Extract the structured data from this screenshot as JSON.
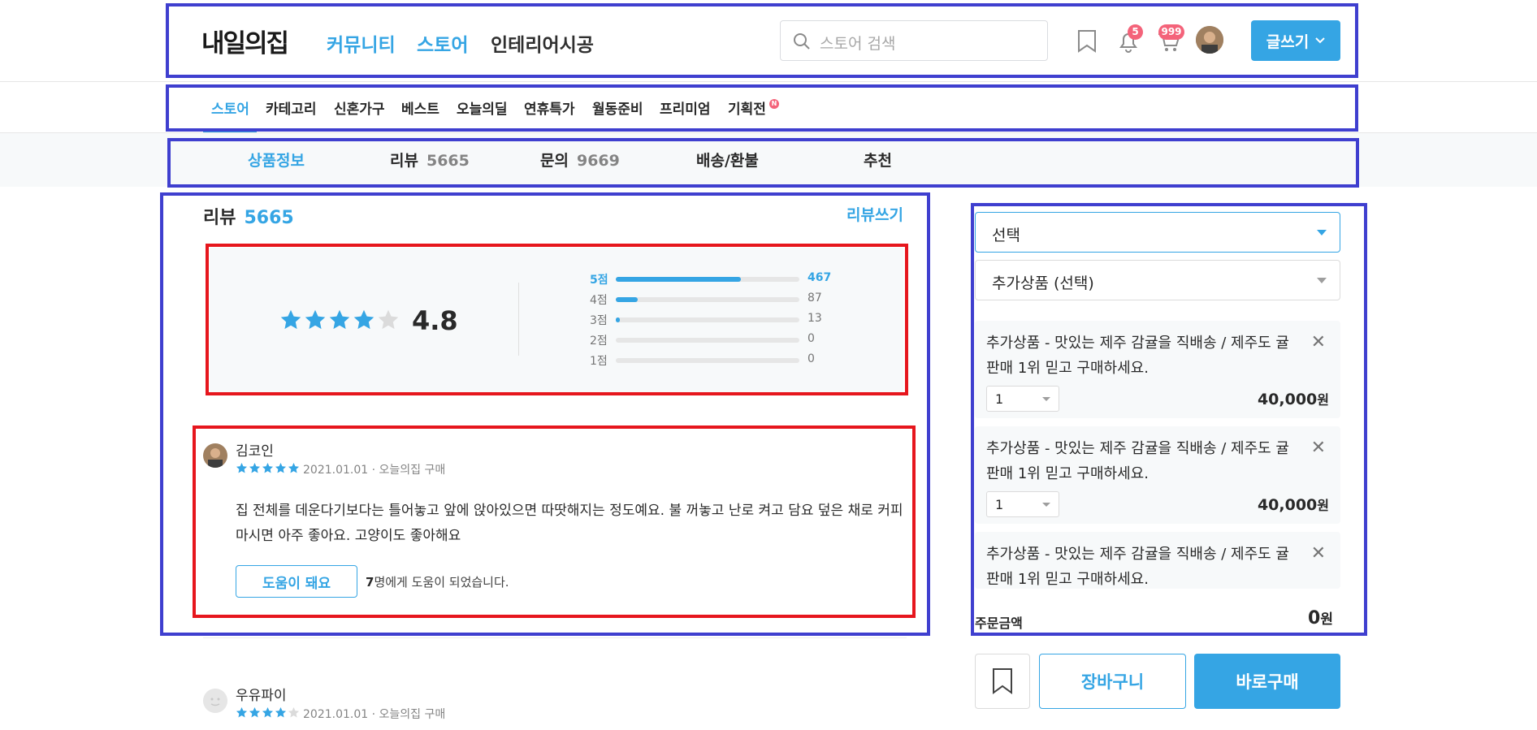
{
  "header": {
    "logo": "내일의집",
    "nav": [
      "커뮤니티",
      "스토어",
      "인테리어시공"
    ],
    "search_placeholder": "스토어 검색",
    "notification_count": "5",
    "cart_count": "999",
    "write_label": "글쓰기"
  },
  "subnav": {
    "items": [
      "스토어",
      "카테고리",
      "신혼가구",
      "베스트",
      "오늘의딜",
      "연휴특가",
      "월동준비",
      "프리미엄",
      "기획전"
    ],
    "new_badge": "N"
  },
  "tabs": [
    {
      "label": "상품정보",
      "count": ""
    },
    {
      "label": "리뷰",
      "count": "5665"
    },
    {
      "label": "문의",
      "count": "9669"
    },
    {
      "label": "배송/환불",
      "count": ""
    },
    {
      "label": "추천",
      "count": ""
    }
  ],
  "review": {
    "title": "리뷰",
    "count": "5665",
    "write_label": "리뷰쓰기",
    "average": "4.8",
    "average_stars": 4,
    "distribution": [
      {
        "label": "5점",
        "count": "467",
        "fraction": 0.68
      },
      {
        "label": "4점",
        "count": "87",
        "fraction": 0.12
      },
      {
        "label": "3점",
        "count": "13",
        "fraction": 0.02
      },
      {
        "label": "2점",
        "count": "0",
        "fraction": 0
      },
      {
        "label": "1점",
        "count": "0",
        "fraction": 0
      }
    ],
    "items": [
      {
        "author": "김코인",
        "meta": "2021.01.01 · 오늘의집 구매",
        "stars": 5,
        "body": "집 전체를 데운다기보다는 틀어놓고 앞에 앉아있으면 따땃해지는 정도예요. 불 꺼놓고 난로 켜고 담요 덮은 채로 커피 마시면 아주 좋아요. 고양이도 좋아해요",
        "helpful_label": "도움이 돼요",
        "helpful_count": "7",
        "helpful_text": "명에게 도움이 되었습니다."
      },
      {
        "author": "우유파이",
        "meta": "2021.01.01 · 오늘의집 구매",
        "stars": 4
      }
    ]
  },
  "sidebar": {
    "select_label": "선택",
    "addon_select_label": "추가상품 (선택)",
    "options": [
      {
        "name": "추가상품 - 맛있는 제주 감귤을 직배송 / 제주도 귤 판매 1위 믿고 구매하세요.",
        "qty": "1",
        "price": "40,000",
        "unit": "원"
      },
      {
        "name": "추가상품 - 맛있는 제주 감귤을 직배송 / 제주도 귤 판매 1위 믿고 구매하세요.",
        "qty": "1",
        "price": "40,000",
        "unit": "원"
      },
      {
        "name": "추가상품 - 맛있는 제주 감귤을 직배송 / 제주도 귤 판매 1위 믿고 구매하세요.",
        "qty": "",
        "price": "",
        "unit": ""
      }
    ],
    "total_label": "주문금액",
    "total_value": "0",
    "total_unit": "원",
    "cart_label": "장바구니",
    "buy_label": "바로구매"
  },
  "colors": {
    "accent": "#35a5e4",
    "badge": "#f4637a",
    "annotation_blue": "#3f3fcf",
    "annotation_red": "#e6161d"
  }
}
